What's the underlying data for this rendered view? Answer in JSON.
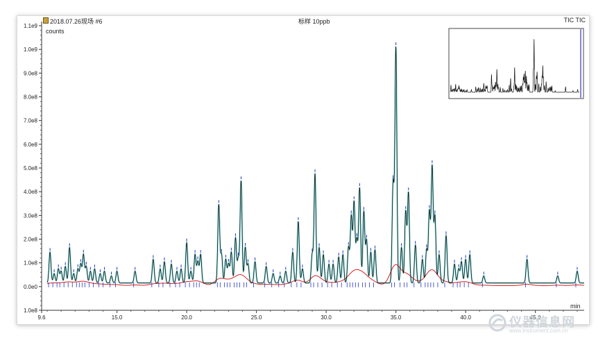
{
  "header": {
    "sample": "2018.07.26现场 #6",
    "center": "标样  10ppb",
    "right": "TIC TIC"
  },
  "watermark": {
    "name": "仪器信息网",
    "url": "www.instrument.com.cn"
  },
  "colors": {
    "tic": "#111111",
    "baseline": "#d62020",
    "fill": "#3cc8c8",
    "marker": "#2233cc"
  },
  "chart_data": {
    "type": "line",
    "title": "",
    "xlabel": "min",
    "ylabel": "counts",
    "xlim": [
      9.6,
      48.5
    ],
    "ylim": [
      -100000000.0,
      1100000000.0
    ],
    "x_ticks": [
      9.6,
      15.0,
      20.0,
      25.0,
      30.0,
      35.0,
      40.0,
      45.0
    ],
    "x_tick_labels": [
      "9.6",
      "15.0",
      "20.0",
      "25.0",
      "30.0",
      "35.0",
      "40.0",
      "45.0"
    ],
    "y_ticks": [
      -100000000.0,
      0,
      100000000.0,
      200000000.0,
      300000000.0,
      400000000.0,
      500000000.0,
      600000000.0,
      700000000.0,
      800000000.0,
      900000000.0,
      1000000000.0,
      1100000000.0
    ],
    "y_tick_labels": [
      "1.0e8",
      "0.0e0",
      "1.0e8",
      "2.0e8",
      "3.0e8",
      "4.0e8",
      "5.0e8",
      "6.0e8",
      "7.0e8",
      "8.0e8",
      "9.0e8",
      "1.0e9",
      "1.1e9"
    ],
    "grid": false,
    "series": [
      {
        "peaks": [
          [
            10.2,
            130000000.0
          ],
          [
            10.5,
            40000000.0
          ],
          [
            10.8,
            60000000.0
          ],
          [
            11.0,
            50000000.0
          ],
          [
            11.3,
            70000000.0
          ],
          [
            11.6,
            150000000.0
          ],
          [
            11.9,
            40000000.0
          ],
          [
            12.2,
            60000000.0
          ],
          [
            12.4,
            80000000.0
          ],
          [
            12.6,
            120000000.0
          ],
          [
            12.8,
            70000000.0
          ],
          [
            13.1,
            50000000.0
          ],
          [
            13.4,
            60000000.0
          ],
          [
            13.8,
            40000000.0
          ],
          [
            14.1,
            50000000.0
          ],
          [
            14.6,
            30000000.0
          ],
          [
            15.0,
            50000000.0
          ],
          [
            16.3,
            50000000.0
          ],
          [
            17.6,
            100000000.0
          ],
          [
            18.1,
            60000000.0
          ],
          [
            18.4,
            90000000.0
          ],
          [
            18.9,
            80000000.0
          ],
          [
            19.3,
            50000000.0
          ],
          [
            19.6,
            60000000.0
          ],
          [
            20.0,
            170000000.0
          ],
          [
            20.3,
            50000000.0
          ],
          [
            20.6,
            120000000.0
          ],
          [
            20.8,
            90000000.0
          ],
          [
            21.0,
            120000000.0
          ],
          [
            22.3,
            330000000.0
          ],
          [
            22.5,
            120000000.0
          ],
          [
            22.8,
            100000000.0
          ],
          [
            23.0,
            80000000.0
          ],
          [
            23.2,
            130000000.0
          ],
          [
            23.5,
            190000000.0
          ],
          [
            23.7,
            100000000.0
          ],
          [
            23.9,
            430000000.0
          ],
          [
            24.2,
            150000000.0
          ],
          [
            24.4,
            80000000.0
          ],
          [
            24.9,
            90000000.0
          ],
          [
            25.7,
            70000000.0
          ],
          [
            26.2,
            40000000.0
          ],
          [
            26.7,
            30000000.0
          ],
          [
            27.1,
            50000000.0
          ],
          [
            27.6,
            130000000.0
          ],
          [
            28.0,
            260000000.0
          ],
          [
            28.3,
            60000000.0
          ],
          [
            29.0,
            120000000.0
          ],
          [
            29.2,
            460000000.0
          ],
          [
            29.5,
            150000000.0
          ],
          [
            29.8,
            120000000.0
          ],
          [
            30.2,
            80000000.0
          ],
          [
            30.5,
            80000000.0
          ],
          [
            30.9,
            110000000.0
          ],
          [
            31.2,
            120000000.0
          ],
          [
            31.6,
            150000000.0
          ],
          [
            31.8,
            280000000.0
          ],
          [
            32.0,
            340000000.0
          ],
          [
            32.2,
            180000000.0
          ],
          [
            32.4,
            400000000.0
          ],
          [
            32.7,
            300000000.0
          ],
          [
            32.9,
            180000000.0
          ],
          [
            33.2,
            130000000.0
          ],
          [
            33.5,
            140000000.0
          ],
          [
            34.8,
            420000000.0
          ],
          [
            35.0,
            990000000.0
          ],
          [
            35.4,
            150000000.0
          ],
          [
            35.7,
            300000000.0
          ],
          [
            35.9,
            380000000.0
          ],
          [
            36.4,
            160000000.0
          ],
          [
            36.9,
            100000000.0
          ],
          [
            37.2,
            140000000.0
          ],
          [
            37.4,
            300000000.0
          ],
          [
            37.6,
            490000000.0
          ],
          [
            37.8,
            280000000.0
          ],
          [
            38.1,
            120000000.0
          ],
          [
            38.6,
            200000000.0
          ],
          [
            39.2,
            80000000.0
          ],
          [
            39.5,
            60000000.0
          ],
          [
            39.7,
            90000000.0
          ],
          [
            40.0,
            100000000.0
          ],
          [
            40.3,
            120000000.0
          ],
          [
            41.3,
            30000000.0
          ],
          [
            44.4,
            100000000.0
          ],
          [
            46.6,
            30000000.0
          ],
          [
            48.0,
            50000000.0
          ]
        ]
      }
    ]
  }
}
